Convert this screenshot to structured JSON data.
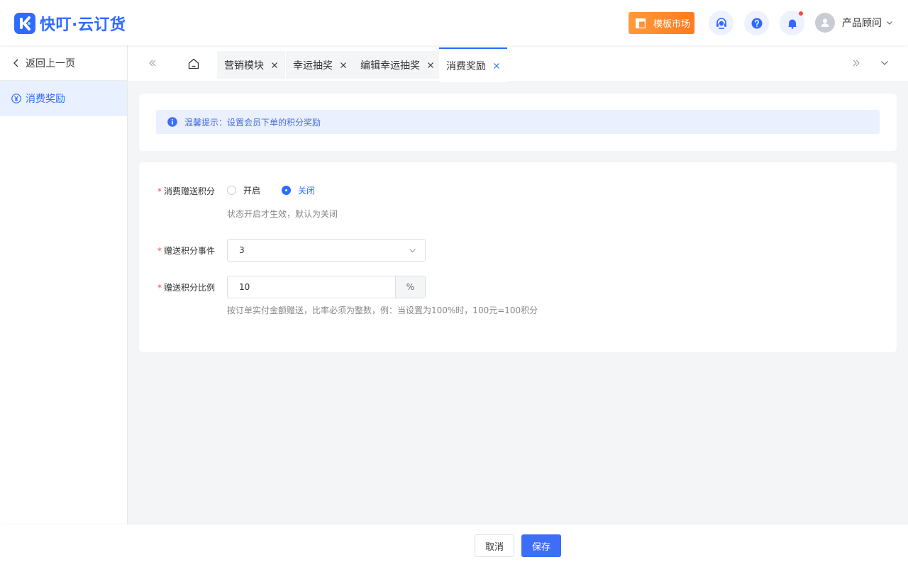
{
  "header": {
    "brand": "快叮·云订货",
    "market_label": "模板市场",
    "user_name": "产品顾问",
    "colors": {
      "brand": "#2f6bff",
      "market": "#ff8a2a",
      "badge": "#f5483b"
    }
  },
  "sidebar": {
    "back_label": "返回上一页",
    "items": [
      {
        "label": "消费奖励",
        "active": true
      }
    ]
  },
  "tabs": [
    {
      "label": "营销模块",
      "active": false
    },
    {
      "label": "幸运抽奖",
      "active": false
    },
    {
      "label": "编辑幸运抽奖",
      "active": false
    },
    {
      "label": "消费奖励",
      "active": true
    }
  ],
  "tip": {
    "text": "温馨提示：设置会员下单的积分奖励"
  },
  "form": {
    "points_toggle": {
      "label": "消费赠送积分",
      "options": [
        "开启",
        "关闭"
      ],
      "selected": "关闭",
      "help": "状态开启才生效，默认为关闭"
    },
    "event": {
      "label": "赠送积分事件",
      "value": "3"
    },
    "ratio": {
      "label": "赠送积分比例",
      "value": "10",
      "unit": "%",
      "help": "按订单实付金额赠送，比率必须为整数，例：当设置为100%时，100元=100积分"
    }
  },
  "footer": {
    "cancel_label": "取消",
    "save_label": "保存"
  }
}
